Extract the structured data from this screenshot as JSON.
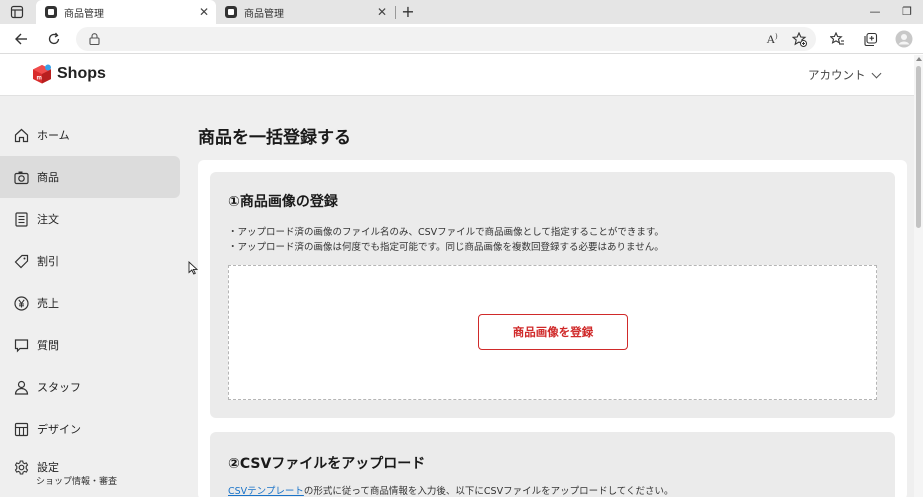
{
  "browser": {
    "tabs": [
      {
        "title": "商品管理",
        "active": true
      },
      {
        "title": "商品管理",
        "active": false
      }
    ],
    "address": ""
  },
  "header": {
    "brand": "Shops",
    "account_label": "アカウント"
  },
  "sidebar": {
    "items": [
      {
        "label": "ホーム",
        "icon": "home-icon"
      },
      {
        "label": "商品",
        "icon": "camera-icon",
        "active": true
      },
      {
        "label": "注文",
        "icon": "list-icon"
      },
      {
        "label": "割引",
        "icon": "tag-icon"
      },
      {
        "label": "売上",
        "icon": "yen-icon"
      },
      {
        "label": "質問",
        "icon": "chat-icon"
      },
      {
        "label": "スタッフ",
        "icon": "person-icon"
      },
      {
        "label": "デザイン",
        "icon": "grid-icon"
      },
      {
        "label": "設定",
        "icon": "gear-icon",
        "sub": "ショップ情報・審査"
      }
    ]
  },
  "main": {
    "page_title": "商品を一括登録する",
    "section1": {
      "title": "①商品画像の登録",
      "notes": [
        "・アップロード済の画像のファイル名のみ、CSVファイルで商品画像として指定することができます。",
        "・アップロード済の画像は何度でも指定可能です。同じ商品画像を複数回登録する必要はありません。"
      ],
      "button_label": "商品画像を登録"
    },
    "section2": {
      "title": "②CSVファイルをアップロード",
      "link_text": "CSVテンプレート",
      "desc_rest": "の形式に従って商品情報を入力後、以下にCSVファイルをアップロードしてください。"
    }
  },
  "colors": {
    "accent": "#d02a2a",
    "link": "#1a73c8",
    "sidebar_active": "#dcdcdc",
    "page_bg": "#efefef"
  }
}
